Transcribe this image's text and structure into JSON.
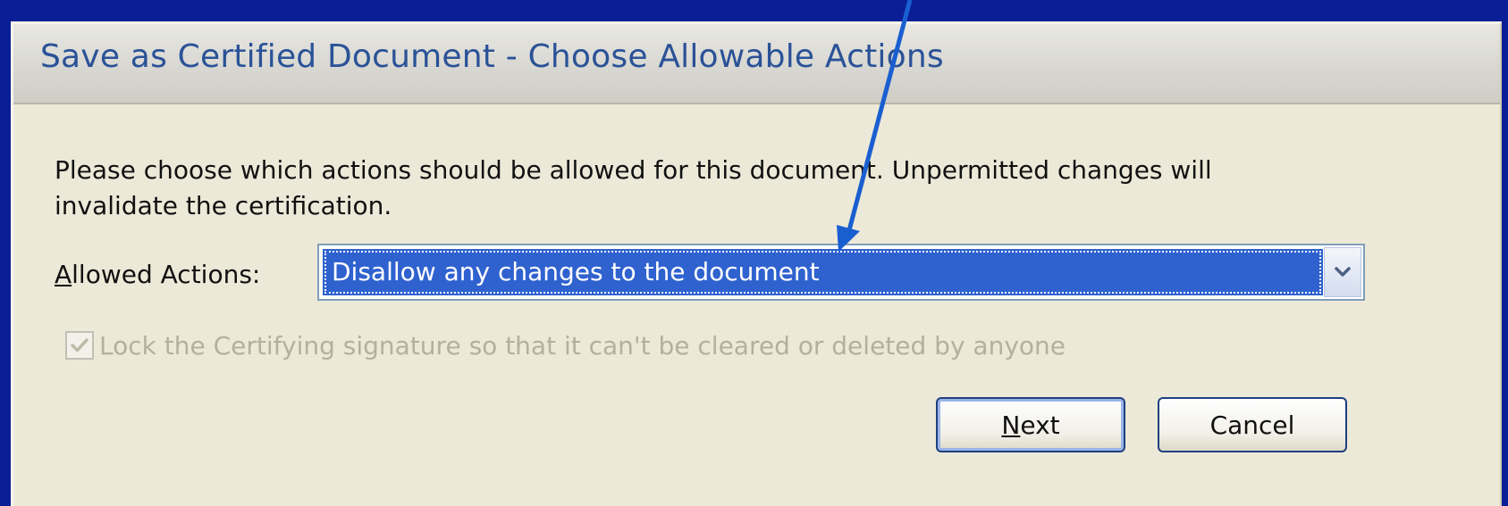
{
  "dialog": {
    "title": "Save as Certified Document - Choose Allowable Actions",
    "description": "Please choose which actions should be allowed for this document. Unpermitted changes will invalidate the certification.",
    "allowed_actions": {
      "label_mnemonic": "A",
      "label_rest": "llowed Actions:",
      "selected_value": "Disallow any changes to the document"
    },
    "lock_checkbox": {
      "label": "Lock the Certifying signature so that it can't be cleared or deleted by anyone",
      "checked": true,
      "disabled": true
    },
    "buttons": {
      "next_mnemonic": "N",
      "next_rest": "ext",
      "cancel_label": "Cancel"
    }
  },
  "icons": {
    "dropdown": "chevron-down-icon",
    "check": "check-icon",
    "annotation": "arrow-icon"
  },
  "colors": {
    "background": "#0a1e96",
    "dialog_face": "#ede9d8",
    "title_text": "#2a5297",
    "selection": "#2f62cf",
    "annotation_arrow": "#1a5fd0"
  }
}
